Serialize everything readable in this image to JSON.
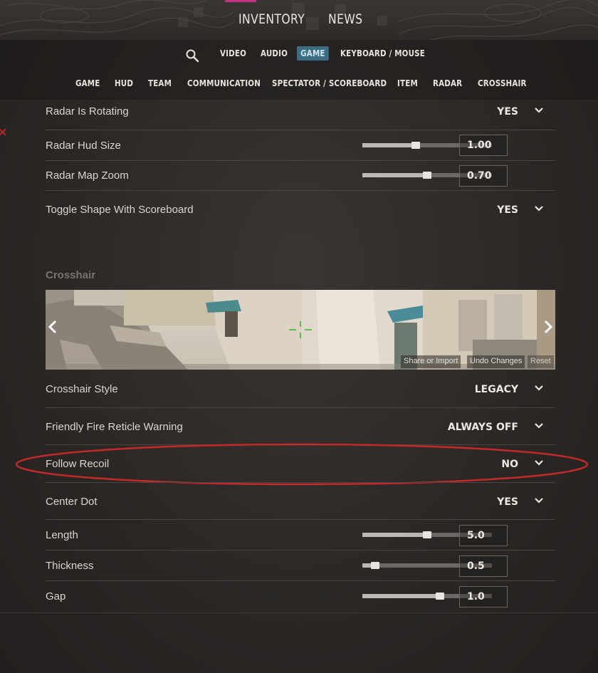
{
  "top_tabs": {
    "inventory": "INVENTORY",
    "news": "NEWS"
  },
  "nav_primary": {
    "items": [
      "VIDEO",
      "AUDIO",
      "GAME",
      "KEYBOARD / MOUSE"
    ],
    "active": "GAME"
  },
  "nav_secondary": {
    "items": [
      "GAME",
      "HUD",
      "TEAM",
      "COMMUNICATION",
      "SPECTATOR / SCOREBOARD",
      "ITEM",
      "RADAR",
      "CROSSHAIR"
    ]
  },
  "radar": {
    "rotating": {
      "label": "Radar Is Rotating",
      "value": "YES"
    },
    "hud_size": {
      "label": "Radar Hud Size",
      "value": "1.00",
      "level": 0.41
    },
    "map_zoom": {
      "label": "Radar Map Zoom",
      "value": "0.70",
      "level": 0.5
    },
    "toggle_shape": {
      "label": "Toggle Shape With Scoreboard",
      "value": "YES"
    }
  },
  "crosshair": {
    "section_title": "Crosshair",
    "preview_buttons": {
      "share": "Share or Import",
      "undo": "Undo Changes",
      "reset": "Reset"
    },
    "style": {
      "label": "Crosshair Style",
      "value": "LEGACY"
    },
    "friendly_fire": {
      "label": "Friendly Fire Reticle Warning",
      "value": "ALWAYS OFF"
    },
    "follow_recoil": {
      "label": "Follow Recoil",
      "value": "NO"
    },
    "center_dot": {
      "label": "Center Dot",
      "value": "YES"
    },
    "length": {
      "label": "Length",
      "value": "5.0",
      "level": 0.5
    },
    "thickness": {
      "label": "Thickness",
      "value": "0.5",
      "level": 0.1
    },
    "gap": {
      "label": "Gap",
      "value": "1.0",
      "level": 0.6
    }
  },
  "colors": {
    "active_tab": "#3d6d82",
    "annotation_red": "#c22a2a",
    "crosshair_green": "#5fbf4a"
  }
}
